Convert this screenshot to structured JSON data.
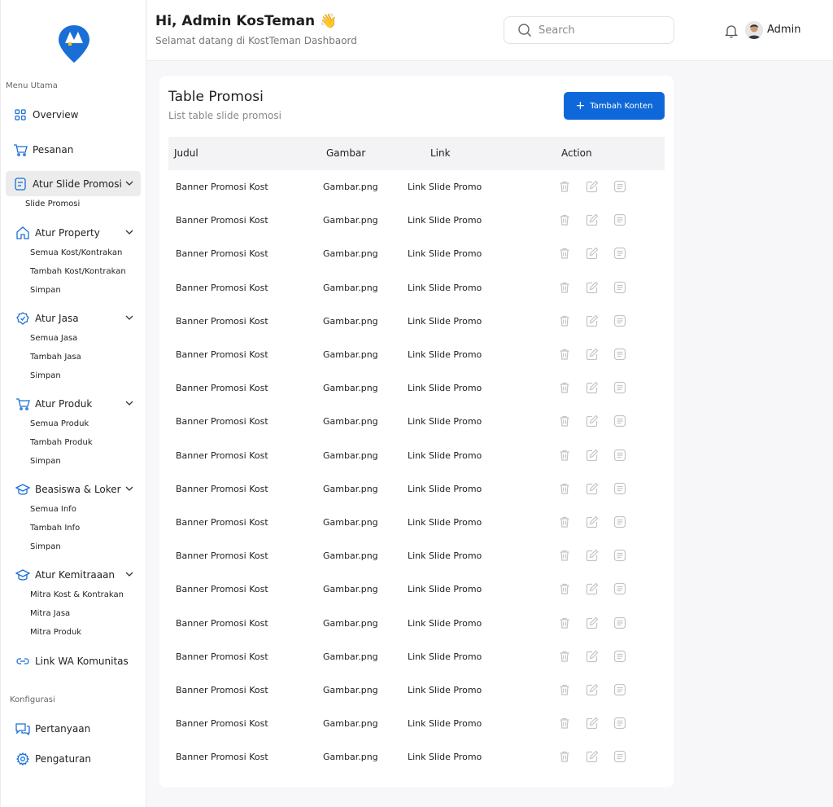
{
  "sidebar": {
    "menu_label": "Menu Utama",
    "config_label": "Konfigurasi",
    "overview": "Overview",
    "pesanan": "Pesanan",
    "atur_slide": "Atur Slide Promosi",
    "slide_promosi": "Slide Promosi",
    "atur_property": "Atur Property",
    "property_items": [
      "Semua Kost/Kontrakan",
      "Tambah Kost/Kontrakan",
      "Simpan"
    ],
    "atur_jasa": "Atur Jasa",
    "jasa_items": [
      "Semua Jasa",
      "Tambah Jasa",
      "Simpan"
    ],
    "atur_produk": "Atur Produk",
    "produk_items": [
      "Semua Produk",
      "Tambah Produk",
      "Simpan"
    ],
    "beasiswa": "Beasiswa & Loker",
    "beasiswa_items": [
      "Semua Info",
      "Tambah Info",
      "Simpan"
    ],
    "kemitraan": "Atur Kemitraaan",
    "kemitraan_items": [
      "Mitra Kost & Kontrakan",
      "Mitra Jasa",
      "Mitra Produk"
    ],
    "link_wa": "Link WA Komunitas",
    "pertanyaan": "Pertanyaan",
    "pengaturan": "Pengaturan"
  },
  "header": {
    "greeting": "Hi, Admin KosTeman 👋",
    "subtitle": "Selamat datang di KostTeman Dashbaord",
    "search_placeholder": "Search",
    "user_name": "Admin"
  },
  "card": {
    "title": "Table Promosi",
    "subtitle": "List table slide promosi",
    "add_button": "Tambah Konten"
  },
  "table": {
    "columns": [
      "Judul",
      "Gambar",
      "Link",
      "Action"
    ],
    "rows": [
      [
        "Banner Promosi Kost",
        "Gambar.png",
        "Link Slide Promo"
      ],
      [
        "Banner Promosi Kost",
        "Gambar.png",
        "Link Slide Promo"
      ],
      [
        "Banner Promosi Kost",
        "Gambar.png",
        "Link Slide Promo"
      ],
      [
        "Banner Promosi Kost",
        "Gambar.png",
        "Link Slide Promo"
      ],
      [
        "Banner Promosi Kost",
        "Gambar.png",
        "Link Slide Promo"
      ],
      [
        "Banner Promosi Kost",
        "Gambar.png",
        "Link Slide Promo"
      ],
      [
        "Banner Promosi Kost",
        "Gambar.png",
        "Link Slide Promo"
      ],
      [
        "Banner Promosi Kost",
        "Gambar.png",
        "Link Slide Promo"
      ],
      [
        "Banner Promosi Kost",
        "Gambar.png",
        "Link Slide Promo"
      ],
      [
        "Banner Promosi Kost",
        "Gambar.png",
        "Link Slide Promo"
      ],
      [
        "Banner Promosi Kost",
        "Gambar.png",
        "Link Slide Promo"
      ],
      [
        "Banner Promosi Kost",
        "Gambar.png",
        "Link Slide Promo"
      ],
      [
        "Banner Promosi Kost",
        "Gambar.png",
        "Link Slide Promo"
      ],
      [
        "Banner Promosi Kost",
        "Gambar.png",
        "Link Slide Promo"
      ],
      [
        "Banner Promosi Kost",
        "Gambar.png",
        "Link Slide Promo"
      ],
      [
        "Banner Promosi Kost",
        "Gambar.png",
        "Link Slide Promo"
      ],
      [
        "Banner Promosi Kost",
        "Gambar.png",
        "Link Slide Promo"
      ],
      [
        "Banner Promosi Kost",
        "Gambar.png",
        "Link Slide Promo"
      ]
    ],
    "action_icons": [
      "trash-icon",
      "edit-icon",
      "detail-icon"
    ]
  },
  "colors": {
    "accent": "#0e68d9",
    "active_bg": "#ececec",
    "icon_gray": "#c4c4c4"
  }
}
